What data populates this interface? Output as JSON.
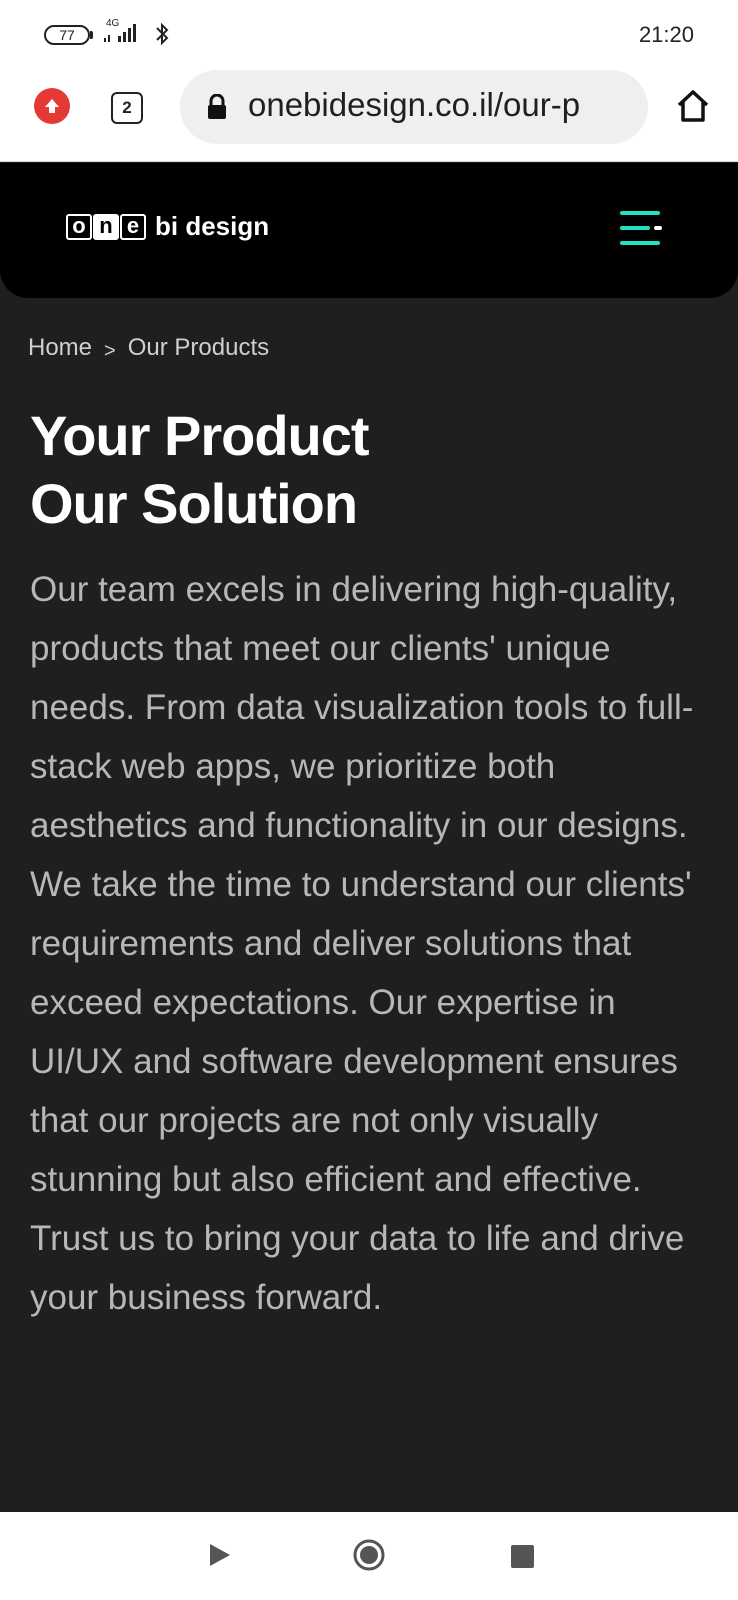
{
  "status_bar": {
    "battery": "77",
    "network": "4G",
    "time": "21:20",
    "icons": [
      "battery-icon",
      "signal-icon",
      "bluetooth-icon"
    ]
  },
  "browser": {
    "tab_count": "2",
    "url": "onebidesign.co.il/our-p",
    "icons": [
      "update-icon",
      "lock-icon",
      "home-icon"
    ]
  },
  "site": {
    "logo_letters": [
      "o",
      "n",
      "e"
    ],
    "logo_text": "bi design",
    "menu_icon": "hamburger-menu-icon",
    "accent_colors": [
      "#22e0c0",
      "#ffffff"
    ]
  },
  "breadcrumb": {
    "home": "Home",
    "separator": ">",
    "current": "Our Products"
  },
  "page": {
    "title_line1": "Your Product",
    "title_line2": "Our Solution",
    "description": "Our team excels in delivering high-quality, products that meet our clients' unique needs. From data visualization tools to full-stack web apps, we prioritize both aesthetics and functionality in our designs. We take the time to understand our clients' requirements and deliver solutions that exceed expectations. Our expertise in UI/UX and software development ensures that our projects are not only visually stunning but also efficient and effective. Trust us to bring your data to life and drive your business forward."
  },
  "nav": {
    "icons": [
      "back-triangle-icon",
      "home-circle-icon",
      "recents-square-icon"
    ]
  },
  "colors": {
    "page_background": "#1f1f1f",
    "header_background": "#000000",
    "title_color": "#ffffff",
    "body_text_color": "#b7b7b7"
  }
}
